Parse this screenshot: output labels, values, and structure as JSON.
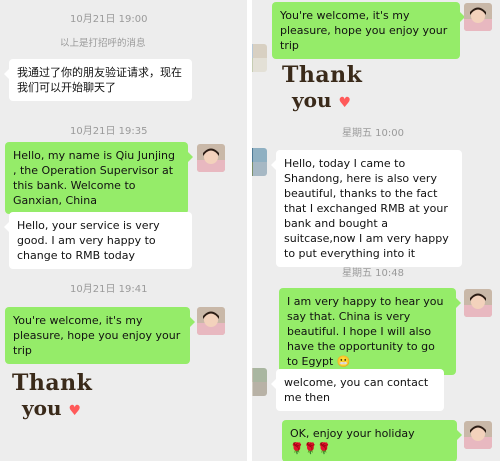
{
  "left": {
    "time1": "10月21日 19:00",
    "system_note": "以上是打招呼的消息",
    "msg_greeting": "我通过了你的朋友验证请求，现在我们可以开始聊天了",
    "time2": "10月21日 19:35",
    "msg_intro": "Hello, my name is Qiu Junjing , the Operation Supervisor  at this bank. Welcome to Ganxian, China",
    "msg_service": "Hello, your service is very good. I am very happy to change to RMB today",
    "time3": "10月21日 19:41",
    "msg_welcome": "You're welcome, it's my pleasure, hope you enjoy your trip",
    "sticker_line1": "Thank",
    "sticker_line2": "you"
  },
  "right": {
    "msg_welcome": "You're welcome, it's my pleasure, hope you enjoy your trip",
    "sticker_line1": "Thank",
    "sticker_line2": "you",
    "time1": "星期五 10:00",
    "msg_shandong": "Hello, today I came to Shandong, here is also very beautiful, thanks to the fact that I exchanged RMB at your bank and bought a suitcase,now I am very happy to put everything into it",
    "time2": "星期五 10:48",
    "msg_egypt": "I am very happy to hear you say that. China is very beautiful. I hope I will also have the opportunity to go to Egypt",
    "msg_egypt_emoji": "😬",
    "msg_contact": "welcome, you can contact me then",
    "msg_holiday": "OK,  enjoy your holiday",
    "msg_holiday_emoji": "🌹🌹🌹"
  },
  "colors": {
    "chat_background": "#ededed",
    "bubble_green": "#95ec69",
    "bubble_white": "#ffffff",
    "timestamp_gray": "#9a9a9a"
  },
  "icons": {
    "heart": "♥"
  }
}
